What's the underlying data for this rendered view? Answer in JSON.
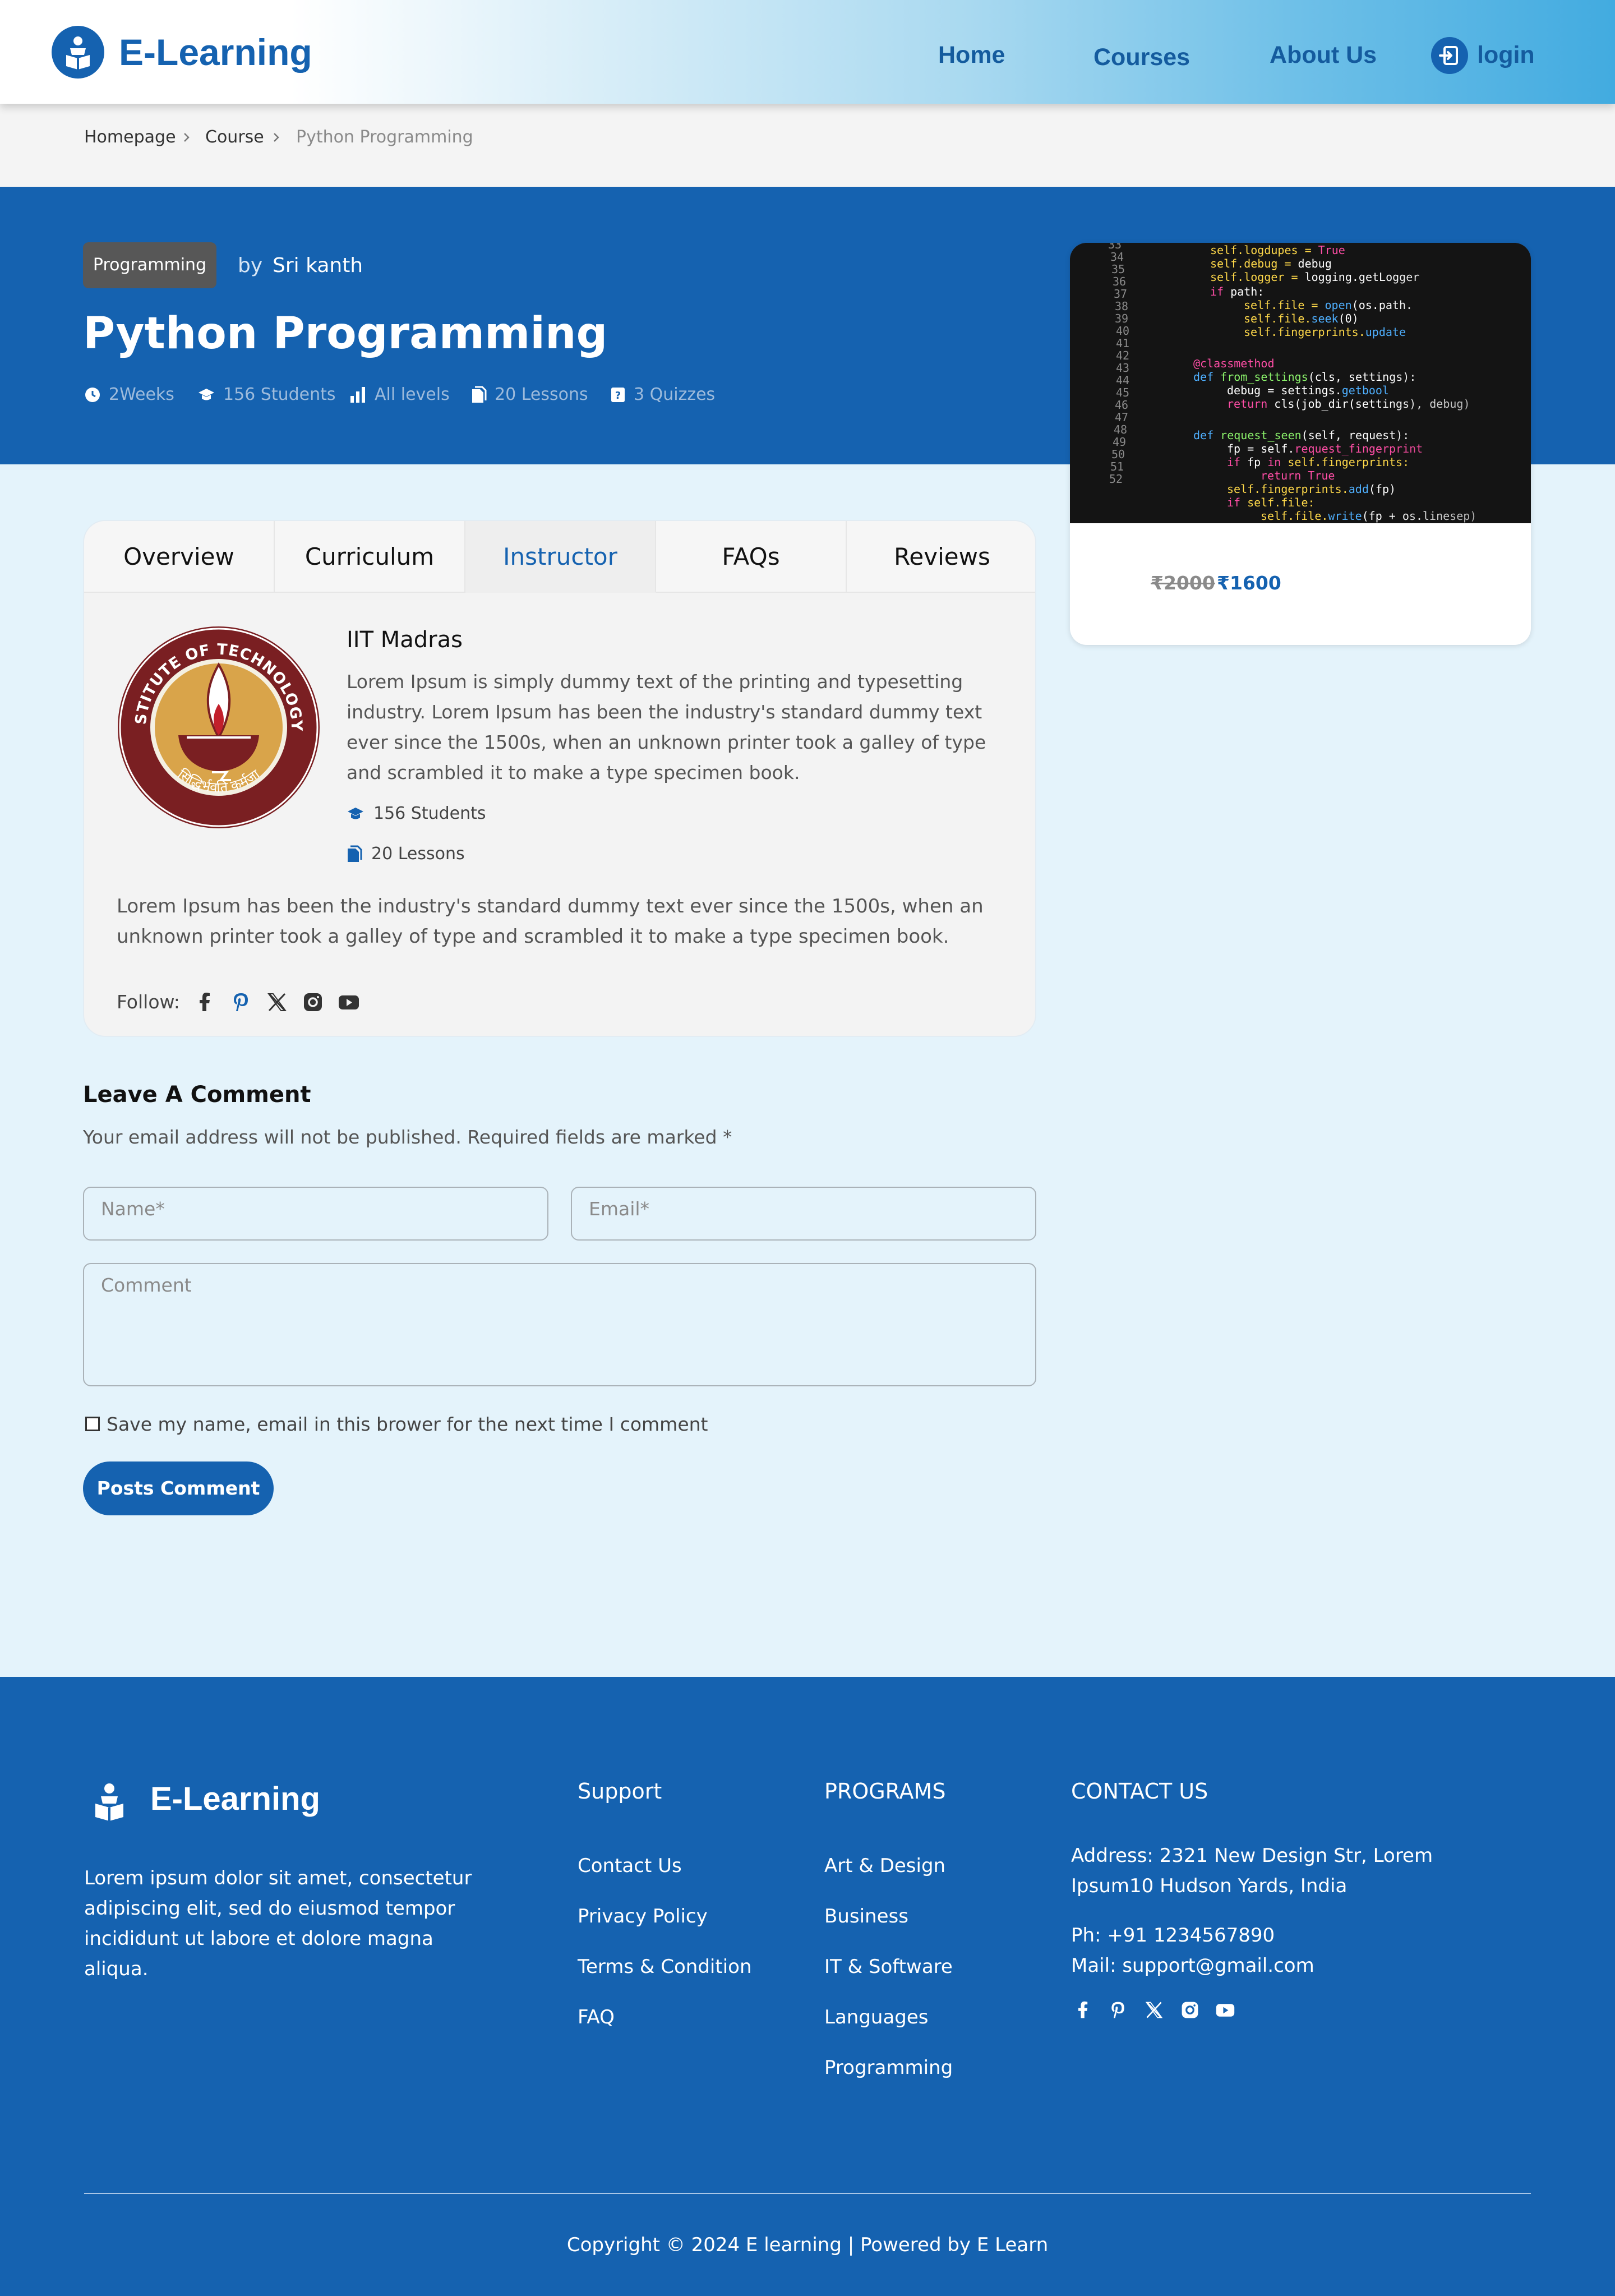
{
  "header": {
    "brand": "E-Learning",
    "nav": [
      "Home",
      "Courses",
      "About Us"
    ],
    "login": "login"
  },
  "breadcrumb": [
    "Homepage",
    "Course",
    "Python Programming"
  ],
  "course": {
    "category": "Programming",
    "by": "by",
    "author": "Sri kanth",
    "title": "Python Programming",
    "meta": {
      "duration": "2Weeks",
      "students": "156 Students",
      "level": "All levels",
      "lessons": "20 Lessons",
      "quizzes": "3 Quizzes"
    },
    "old_price": "₹2000",
    "price": "₹1600"
  },
  "tabs": [
    "Overview",
    "Curriculum",
    "Instructor",
    "FAQs",
    "Reviews"
  ],
  "active_tab": "Instructor",
  "instructor": {
    "name": "IIT Madras",
    "description": "Lorem Ipsum is simply dummy text of the printing and typesetting industry. Lorem Ipsum has been the industry's standard dummy text ever since the 1500s, when an unknown printer took a galley of type and scrambled it to make a type specimen book.",
    "students": "156 Students",
    "lessons": "20 Lessons",
    "bio": "Lorem Ipsum has been the industry's standard dummy text ever since the 1500s, when an unknown printer took a galley of type and scrambled it to make a type specimen book.",
    "follow_label": "Follow:",
    "logo_text_top": "INDIAN INSTITUTE OF TECHNOLOGY MADRAS",
    "logo_text_bottom": "सिद्धिर्भवति कर्मजा"
  },
  "comment": {
    "title": "Leave A Comment",
    "note": "Your email address will not be published. Required fields are marked *",
    "name_placeholder": "Name*",
    "email_placeholder": "Email*",
    "comment_placeholder": "Comment",
    "save_label": "Save my name, email in this brower for the next time I comment",
    "submit": "Posts Comment"
  },
  "footer": {
    "brand": "E-Learning",
    "description": "Lorem ipsum dolor sit amet, consectetur adipiscing elit, sed do eiusmod tempor incididunt ut labore et dolore magna aliqua.",
    "support_title": "Support",
    "support_links": [
      "Contact Us",
      "Privacy Policy",
      "Terms & Condition",
      "FAQ"
    ],
    "programs_title": "PROGRAMS",
    "programs_links": [
      "Art & Design",
      "Business",
      "IT & Software",
      "Languages",
      "Programming"
    ],
    "contact_title": "CONTACT US",
    "address": "Address: 2321 New Design Str, Lorem Ipsum10 Hudson Yards, India",
    "phone": "Ph: +91 1234567890",
    "mail": "Mail: support@gmail.com",
    "copyright": "Copyright © 2024 E learning | Powered by E Learn"
  },
  "colors": {
    "brand_blue": "#1562b0",
    "page_bg": "#e4f3fb",
    "panel_bg": "#f3f3f3"
  },
  "icons": [
    "graduate-logo-icon",
    "login-icon",
    "chevron-right-icon",
    "clock-icon",
    "graduation-cap-icon",
    "bar-chart-icon",
    "file-icon",
    "quiz-icon",
    "facebook-icon",
    "pinterest-icon",
    "x-twitter-icon",
    "instagram-icon",
    "youtube-icon"
  ]
}
